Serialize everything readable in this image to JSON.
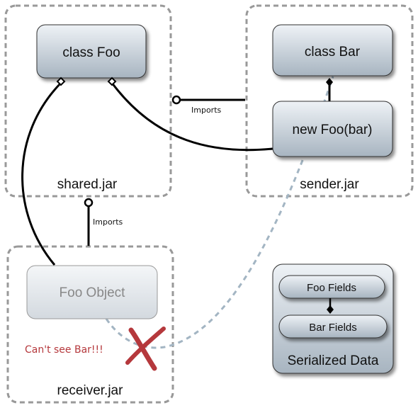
{
  "containers": {
    "shared": "shared.jar",
    "sender": "sender.jar",
    "receiver": "receiver.jar"
  },
  "nodes": {
    "class_foo": "class Foo",
    "class_bar": "class Bar",
    "new_foo": "new Foo(bar)",
    "foo_object": "Foo Object",
    "serialized": "Serialized Data",
    "foo_fields": "Foo Fields",
    "bar_fields": "Bar Fields"
  },
  "edges": {
    "imports_sender": "Imports",
    "imports_receiver": "Imports"
  },
  "annotation": {
    "cant_see": "Can't see Bar!!!"
  },
  "colors": {
    "error": "#b5383c",
    "serialized_link": "#a3b5c3",
    "container_border": "#999999"
  }
}
